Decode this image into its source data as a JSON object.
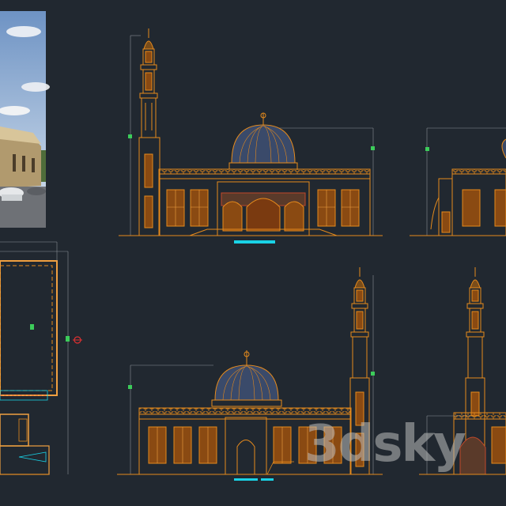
{
  "viewport": {
    "title": "",
    "background": "#212830"
  },
  "colors": {
    "line": "#e58a1c",
    "line_light": "#f0a040",
    "dome": "#3a4a6a",
    "cyan": "#19d2e6",
    "green": "#3ccc5a",
    "dim_gray": "#8a8f96",
    "brick": "#c0482a"
  },
  "drawings": [
    {
      "name": "reference-photo",
      "type": "photograph"
    },
    {
      "name": "front-elevation"
    },
    {
      "name": "side-elevation-cropped"
    },
    {
      "name": "floor-plan"
    },
    {
      "name": "rear-elevation"
    },
    {
      "name": "side-elevation-2-cropped"
    }
  ],
  "watermark": {
    "text": "3dsky",
    "visible": true
  }
}
